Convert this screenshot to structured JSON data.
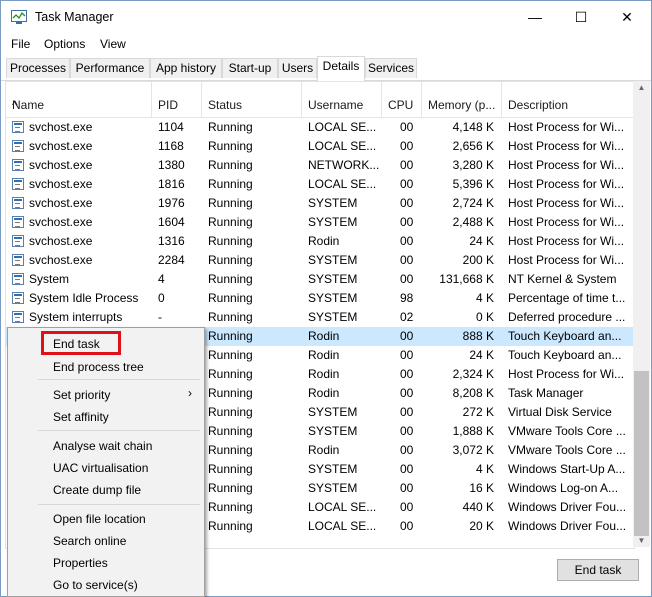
{
  "window": {
    "title": "Task Manager",
    "minimize": "—",
    "maximize": "☐",
    "close": "✕"
  },
  "menu": [
    "File",
    "Options",
    "View"
  ],
  "tabs": [
    "Processes",
    "Performance",
    "App history",
    "Start-up",
    "Users",
    "Details",
    "Services"
  ],
  "active_tab": "Details",
  "columns": [
    "Name",
    "PID",
    "Status",
    "Username",
    "CPU",
    "Memory (p...",
    "Description"
  ],
  "rows": [
    {
      "name": "svchost.exe",
      "pid": "1104",
      "status": "Running",
      "user": "LOCAL SE...",
      "cpu": "00",
      "mem": "4,148 K",
      "desc": "Host Process for Wi..."
    },
    {
      "name": "svchost.exe",
      "pid": "1168",
      "status": "Running",
      "user": "LOCAL SE...",
      "cpu": "00",
      "mem": "2,656 K",
      "desc": "Host Process for Wi..."
    },
    {
      "name": "svchost.exe",
      "pid": "1380",
      "status": "Running",
      "user": "NETWORK...",
      "cpu": "00",
      "mem": "3,280 K",
      "desc": "Host Process for Wi..."
    },
    {
      "name": "svchost.exe",
      "pid": "1816",
      "status": "Running",
      "user": "LOCAL SE...",
      "cpu": "00",
      "mem": "5,396 K",
      "desc": "Host Process for Wi..."
    },
    {
      "name": "svchost.exe",
      "pid": "1976",
      "status": "Running",
      "user": "SYSTEM",
      "cpu": "00",
      "mem": "2,724 K",
      "desc": "Host Process for Wi..."
    },
    {
      "name": "svchost.exe",
      "pid": "1604",
      "status": "Running",
      "user": "SYSTEM",
      "cpu": "00",
      "mem": "2,488 K",
      "desc": "Host Process for Wi..."
    },
    {
      "name": "svchost.exe",
      "pid": "1316",
      "status": "Running",
      "user": "Rodin",
      "cpu": "00",
      "mem": "24 K",
      "desc": "Host Process for Wi..."
    },
    {
      "name": "svchost.exe",
      "pid": "2284",
      "status": "Running",
      "user": "SYSTEM",
      "cpu": "00",
      "mem": "200 K",
      "desc": "Host Process for Wi..."
    },
    {
      "name": "System",
      "pid": "4",
      "status": "Running",
      "user": "SYSTEM",
      "cpu": "00",
      "mem": "131,668 K",
      "desc": "NT Kernel & System"
    },
    {
      "name": "System Idle Process",
      "pid": "0",
      "status": "Running",
      "user": "SYSTEM",
      "cpu": "98",
      "mem": "4 K",
      "desc": "Percentage of time t..."
    },
    {
      "name": "System interrupts",
      "pid": "-",
      "status": "Running",
      "user": "SYSTEM",
      "cpu": "02",
      "mem": "0 K",
      "desc": "Deferred procedure ..."
    },
    {
      "name": "",
      "pid": "",
      "status": "Running",
      "user": "Rodin",
      "cpu": "00",
      "mem": "888 K",
      "desc": "Touch Keyboard an..."
    },
    {
      "name": "",
      "pid": "",
      "status": "Running",
      "user": "Rodin",
      "cpu": "00",
      "mem": "24 K",
      "desc": "Touch Keyboard an..."
    },
    {
      "name": "",
      "pid": "",
      "status": "Running",
      "user": "Rodin",
      "cpu": "00",
      "mem": "2,324 K",
      "desc": "Host Process for Wi..."
    },
    {
      "name": "",
      "pid": "",
      "status": "Running",
      "user": "Rodin",
      "cpu": "00",
      "mem": "8,208 K",
      "desc": "Task Manager"
    },
    {
      "name": "",
      "pid": "",
      "status": "Running",
      "user": "SYSTEM",
      "cpu": "00",
      "mem": "272 K",
      "desc": "Virtual Disk Service"
    },
    {
      "name": "",
      "pid": "",
      "status": "Running",
      "user": "SYSTEM",
      "cpu": "00",
      "mem": "1,888 K",
      "desc": "VMware Tools Core ..."
    },
    {
      "name": "",
      "pid": "",
      "status": "Running",
      "user": "Rodin",
      "cpu": "00",
      "mem": "3,072 K",
      "desc": "VMware Tools Core ..."
    },
    {
      "name": "",
      "pid": "",
      "status": "Running",
      "user": "SYSTEM",
      "cpu": "00",
      "mem": "4 K",
      "desc": "Windows Start-Up A..."
    },
    {
      "name": "",
      "pid": "",
      "status": "Running",
      "user": "SYSTEM",
      "cpu": "00",
      "mem": "16 K",
      "desc": "Windows Log-on A..."
    },
    {
      "name": "",
      "pid": "",
      "status": "Running",
      "user": "LOCAL SE...",
      "cpu": "00",
      "mem": "440 K",
      "desc": "Windows Driver Fou..."
    },
    {
      "name": "",
      "pid": "",
      "status": "Running",
      "user": "LOCAL SE...",
      "cpu": "00",
      "mem": "20 K",
      "desc": "Windows Driver Fou..."
    }
  ],
  "selected_row": 11,
  "context_menu": {
    "items": [
      "End task",
      "End process tree",
      "Set priority",
      "Set affinity",
      "Analyse wait chain",
      "UAC virtualisation",
      "Create dump file",
      "Open file location",
      "Search online",
      "Properties",
      "Go to service(s)"
    ],
    "submenu_arrow": "›"
  },
  "footer": {
    "end_task_label": "End task"
  },
  "colors": {
    "highlight": "#e0101a",
    "selection": "#cce8ff"
  }
}
